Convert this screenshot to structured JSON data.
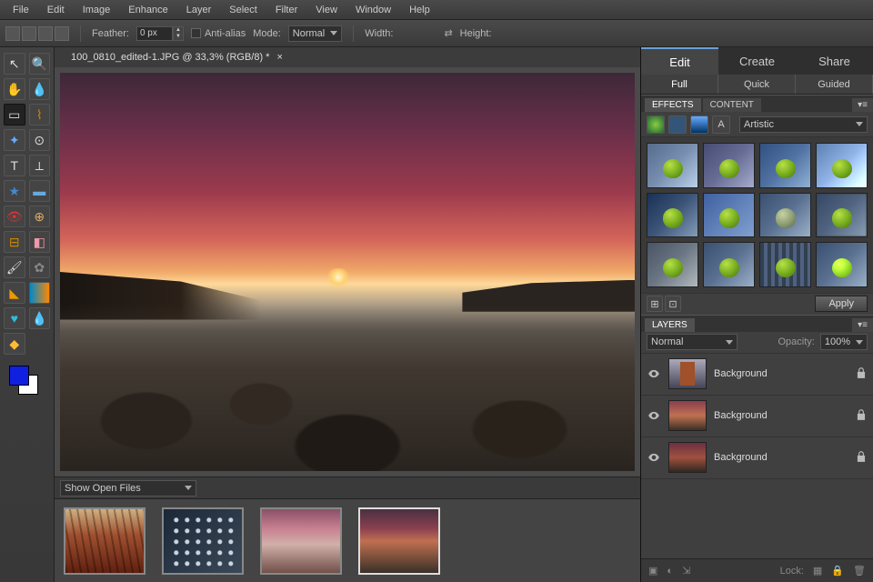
{
  "menubar": [
    "File",
    "Edit",
    "Image",
    "Enhance",
    "Layer",
    "Select",
    "Filter",
    "View",
    "Window",
    "Help"
  ],
  "options": {
    "feather_label": "Feather:",
    "feather_value": "0 px",
    "antialias_label": "Anti-alias",
    "mode_label": "Mode:",
    "mode_value": "Normal",
    "width_label": "Width:",
    "height_label": "Height:"
  },
  "doc": {
    "tab_title": "100_0810_edited-1.JPG @ 33,3% (RGB/8) *"
  },
  "filmstrip": {
    "dropdown": "Show Open Files"
  },
  "right": {
    "top": [
      "Edit",
      "Create",
      "Share"
    ],
    "sub": [
      "Full",
      "Quick",
      "Guided"
    ]
  },
  "effects": {
    "tabs": [
      "EFFECTS",
      "CONTENT"
    ],
    "category": "Artistic",
    "apply": "Apply"
  },
  "layers": {
    "label": "LAYERS",
    "mode": "Normal",
    "opacity_label": "Opacity:",
    "opacity_value": "100%",
    "lock_label": "Lock:",
    "items": [
      {
        "name": "Background"
      },
      {
        "name": "Background"
      },
      {
        "name": "Background"
      }
    ]
  }
}
